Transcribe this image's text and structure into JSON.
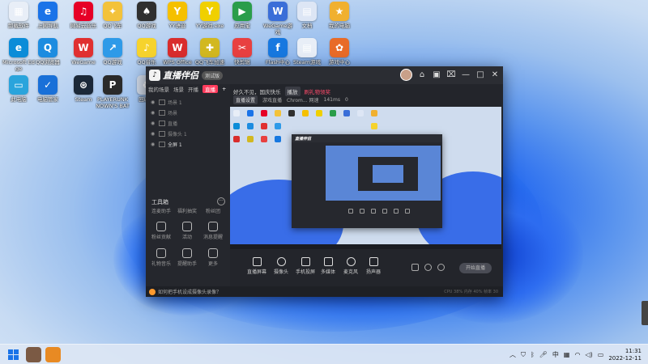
{
  "desktop": {
    "icons": [
      {
        "label": "卸载软件",
        "color": "#e8eef7",
        "glyph": "▦"
      },
      {
        "label": "上网导航",
        "color": "#1a73e8",
        "glyph": "e"
      },
      {
        "label": "网易云音乐",
        "color": "#e60026",
        "glyph": "♫"
      },
      {
        "label": "QQ飞车",
        "color": "#f3c23a",
        "glyph": "✦"
      },
      {
        "label": "QQ游戏",
        "color": "#2f2f2f",
        "glyph": "♠"
      },
      {
        "label": "YY语音",
        "color": "#f5c000",
        "glyph": "Y"
      },
      {
        "label": "YY游戏.exe",
        "color": "#f0d000",
        "glyph": "Y"
      },
      {
        "label": "应用宝",
        "color": "#2a9d4a",
        "glyph": "▶"
      },
      {
        "label": "WeGame游戏",
        "color": "#3a6ed8",
        "glyph": "W"
      },
      {
        "label": "文档",
        "color": "#dde6f5",
        "glyph": "▤"
      },
      {
        "label": "我的电脑",
        "color": "#f0b030",
        "glyph": "★"
      },
      {
        "label": "Microsoft Edge",
        "color": "#0b8cd8",
        "glyph": "e"
      },
      {
        "label": "QQ浏览器",
        "color": "#1d8ce0",
        "glyph": "Q"
      },
      {
        "label": "WeGame",
        "color": "#e03030",
        "glyph": "W"
      },
      {
        "label": "QQ游戏",
        "color": "#2e9ae8",
        "glyph": "↗"
      },
      {
        "label": "QQ音乐",
        "color": "#f6d32d",
        "glyph": "♪"
      },
      {
        "label": "WPS Office",
        "color": "#d92d2d",
        "glyph": "W"
      },
      {
        "label": "QQ飞车加速",
        "color": "#d2b820",
        "glyph": "✚"
      },
      {
        "label": "快剪辑",
        "color": "#e84040",
        "glyph": "✂"
      },
      {
        "label": "Flash中心",
        "color": "#1778e0",
        "glyph": "f"
      },
      {
        "label": "Steam游戏",
        "color": "#e8eef7",
        "glyph": "▤"
      },
      {
        "label": "游戏中心",
        "color": "#e86b28",
        "glyph": "✿"
      },
      {
        "label": "此电脑",
        "color": "#2aa4dc",
        "glyph": "▭"
      },
      {
        "label": "电脑管家",
        "color": "#1970d8",
        "glyph": "✓"
      },
      {
        "label": "Steam",
        "color": "#1b2838",
        "glyph": "⊛"
      },
      {
        "label": "PLAYERUNKNOWN'S BATTLEGR",
        "color": "#2a2a2a",
        "glyph": "P"
      },
      {
        "label": "回收站",
        "color": "#cfd8e6",
        "glyph": "♻"
      },
      {
        "label": "微信多开",
        "color": "#2bb44a",
        "glyph": "✿"
      },
      {
        "label": "QQ炫舞",
        "color": "#e0392d",
        "glyph": "◆"
      },
      {
        "label": "腾讯会议",
        "color": "#1b8be0",
        "glyph": "↗"
      }
    ]
  },
  "app": {
    "name": "直播伴侣",
    "version_tag": "测试版",
    "left_tabs": [
      "我的场景",
      "场景",
      "开播",
      "直播"
    ],
    "active_tab": "直播",
    "scenes": [
      "场景 1",
      "场景",
      "直播",
      "摄像头 1",
      "全屏 1"
    ],
    "tools_title": "工具箱",
    "tools": [
      "连麦助手",
      "福利抽奖",
      "粉丝团",
      "粉丝贡献",
      "活动",
      "消息提醒",
      "礼物音乐",
      "提醒助手",
      "更多"
    ],
    "top_line": [
      "好久不见，国庆快乐",
      "播放",
      "刷礼物领奖"
    ],
    "top_line2": [
      "直播设置",
      "游戏直播",
      "Chrom... 网速",
      "141ms",
      "0"
    ],
    "controls": [
      "直播屏幕",
      "摄像头",
      "手机投屏",
      "多媒体",
      "麦克风",
      "扬声器"
    ],
    "start_button": "开始直播",
    "status_message": "如何把手机设成摄像头录像？",
    "status_right": "CPU 38%  内存 40%  帧率 30",
    "window_icons": [
      "⌂",
      "▣",
      "⌧",
      "—",
      "□",
      "✕"
    ]
  },
  "taskbar": {
    "tray_language": "中",
    "time": "11:31",
    "date": "2022-12-11"
  },
  "colors": {
    "accent": "#ff3b5c",
    "window_bg": "#23252b"
  }
}
